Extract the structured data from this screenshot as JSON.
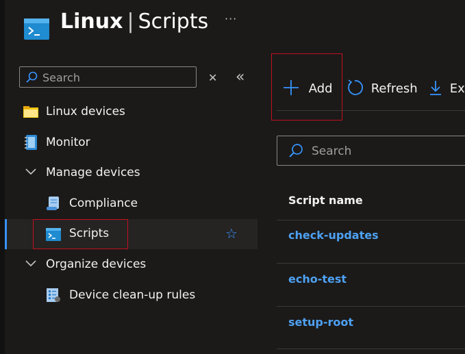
{
  "header": {
    "title_main": "Linux",
    "title_sep": "|",
    "title_sub": "Scripts",
    "more_label": "···",
    "icon": "terminal-icon"
  },
  "sidebar": {
    "search_placeholder": "Search",
    "clear_label": "✕",
    "collapse_label": "«",
    "items": [
      {
        "label": "Linux devices",
        "icon": "folder-icon"
      },
      {
        "label": "Monitor",
        "icon": "notebook-icon"
      },
      {
        "label": "Manage devices",
        "icon": "chevron-down-icon"
      },
      {
        "label": "Compliance",
        "icon": "scroll-icon"
      },
      {
        "label": "Scripts",
        "icon": "terminal-icon",
        "active": true
      },
      {
        "label": "Organize devices",
        "icon": "chevron-down-icon"
      },
      {
        "label": "Device clean-up rules",
        "icon": "checklist-icon"
      }
    ]
  },
  "toolbar": {
    "add_label": "Add",
    "refresh_label": "Refresh",
    "export_label": "Ex"
  },
  "grid": {
    "search_placeholder": "Search",
    "column_header": "Script name",
    "rows": [
      "check-updates",
      "echo-test",
      "setup-root"
    ]
  },
  "colors": {
    "accent": "#3794ff",
    "link": "#4ea1f3",
    "highlight_box": "#c50f1f",
    "background": "#1b1a19"
  }
}
